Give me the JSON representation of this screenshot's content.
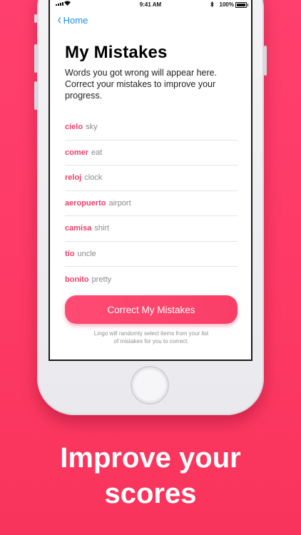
{
  "status": {
    "time": "9:41 AM",
    "battery": "100%"
  },
  "nav": {
    "back_label": "Home"
  },
  "page": {
    "title": "My Mistakes",
    "subtitle": "Words you got wrong will appear here. Correct your mistakes to improve your progress."
  },
  "mistakes": [
    {
      "word": "cielo",
      "translation": "sky"
    },
    {
      "word": "comer",
      "translation": "eat"
    },
    {
      "word": "reloj",
      "translation": "clock"
    },
    {
      "word": "aeropuerto",
      "translation": "airport"
    },
    {
      "word": "camisa",
      "translation": "shirt"
    },
    {
      "word": "tío",
      "translation": "uncle"
    },
    {
      "word": "bonito",
      "translation": "pretty"
    }
  ],
  "cta": {
    "label": "Correct My Mistakes"
  },
  "note": {
    "line1": "Lingo will randomly select items from your list",
    "line2": "of mistakes for you to correct."
  },
  "headline": {
    "line1": "Improve your",
    "line2": "scores"
  },
  "colors": {
    "accent": "#f23d68",
    "link": "#1e8ef1",
    "background": "#fd3a64"
  }
}
